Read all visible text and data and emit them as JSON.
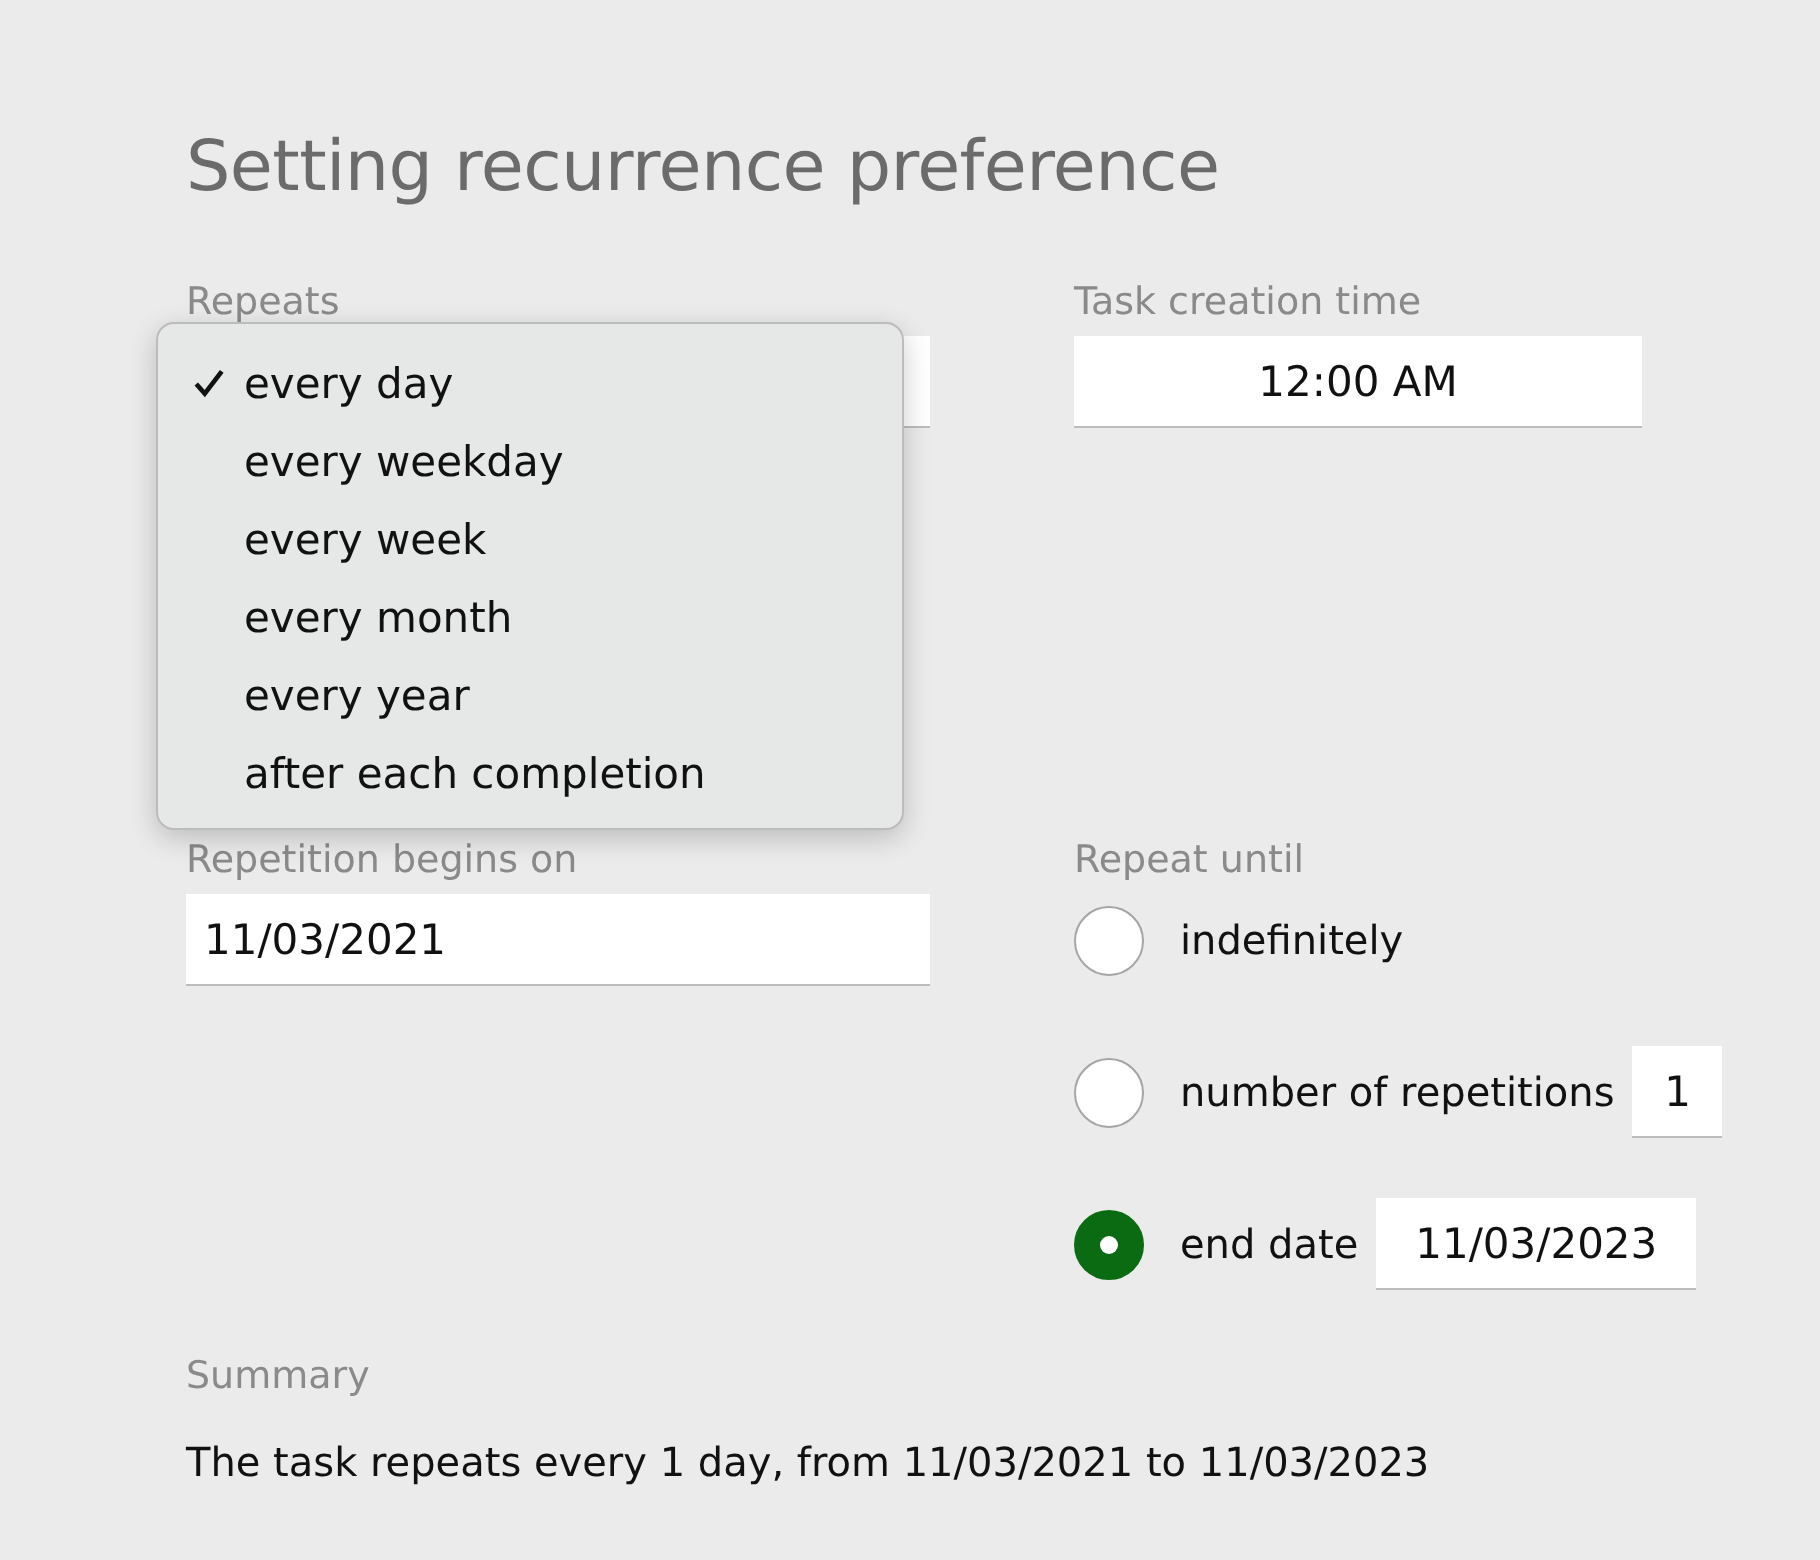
{
  "title": "Setting recurrence preference",
  "repeats": {
    "label": "Repeats",
    "options": [
      {
        "label": "every day",
        "selected": true
      },
      {
        "label": "every weekday",
        "selected": false
      },
      {
        "label": "every week",
        "selected": false
      },
      {
        "label": "every month",
        "selected": false
      },
      {
        "label": "every year",
        "selected": false
      },
      {
        "label": "after each completion",
        "selected": false
      }
    ]
  },
  "task_creation_time": {
    "label": "Task creation time",
    "value": "12:00 AM"
  },
  "repetition_begins_on": {
    "label": "Repetition begins on",
    "value": "11/03/2021"
  },
  "repeat_until": {
    "label": "Repeat until",
    "options": [
      {
        "label": "indefinitely",
        "selected": false
      },
      {
        "label": "number of repetitions",
        "selected": false,
        "value": "1"
      },
      {
        "label": "end date",
        "selected": true,
        "value": "11/03/2023"
      }
    ]
  },
  "summary": {
    "label": "Summary",
    "text": "The task repeats every 1 day, from 11/03/2021 to 11/03/2023"
  }
}
